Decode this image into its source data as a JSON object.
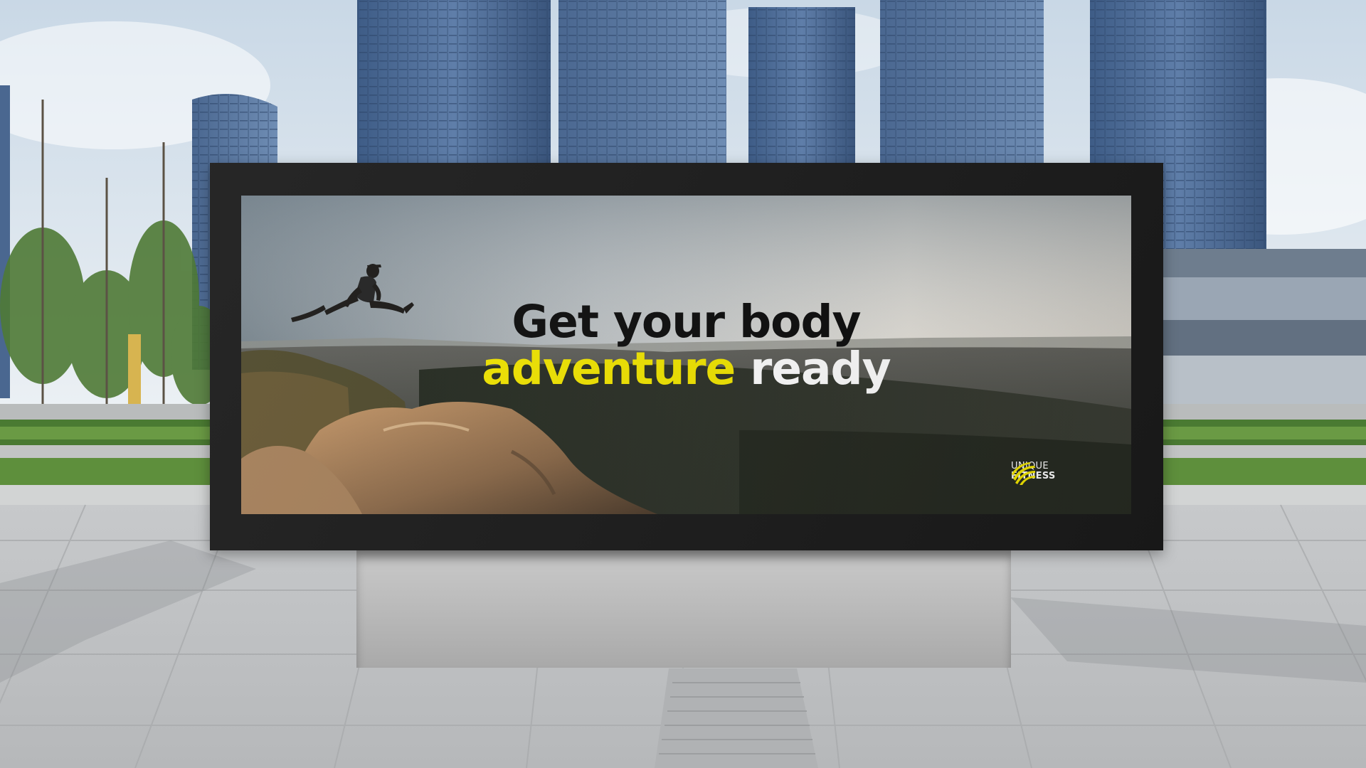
{
  "poster": {
    "headline_line1": "Get your body",
    "headline_word_accent": "adventure",
    "headline_word_plain": "ready"
  },
  "logo": {
    "line1": "UNIQUE",
    "line2": "FITNESS",
    "icon": "striped-hexagon-logo-icon"
  },
  "colors": {
    "accent": "#f2e600",
    "frame": "#1b1b1b",
    "sky": "#dfe7ee",
    "grass": "#5e8f3c",
    "pavement": "#c6c9cb"
  }
}
